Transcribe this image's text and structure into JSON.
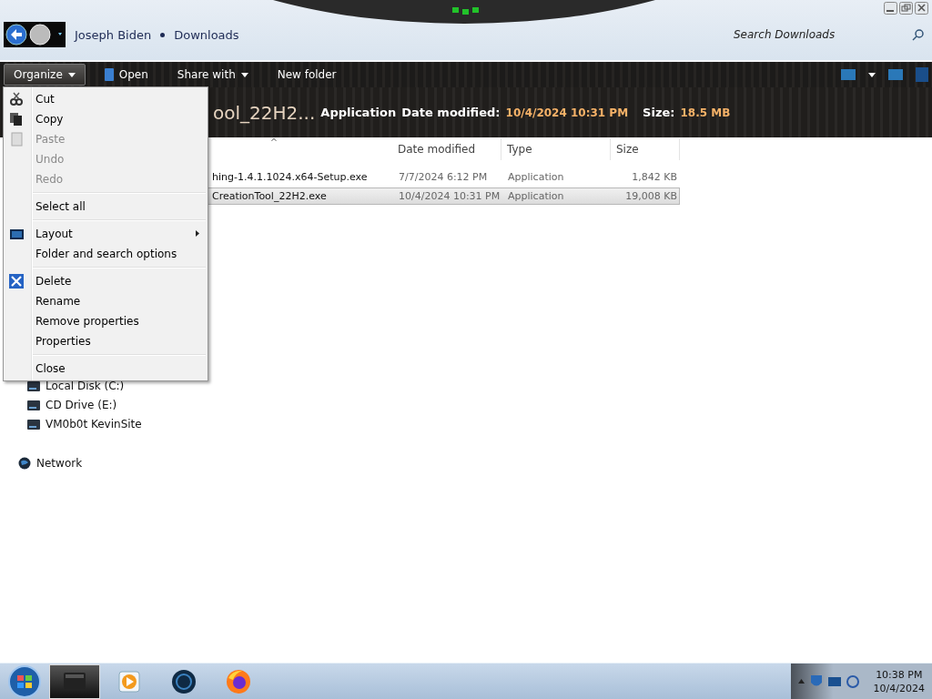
{
  "address": {
    "crumbs": [
      "Joseph Biden",
      "Downloads"
    ]
  },
  "search": {
    "placeholder": "Search Downloads"
  },
  "toolbar": {
    "buttons": [
      {
        "label": "Organize",
        "kind": "dropdown",
        "selected": true
      },
      {
        "label": "Open",
        "kind": "icon"
      },
      {
        "label": "Share with",
        "kind": "dropdown",
        "selected": false
      },
      {
        "label": "New folder",
        "kind": "plain"
      }
    ]
  },
  "details": {
    "title": "ool_22H2...",
    "type": "Application",
    "date_label": "Date modified:",
    "date": "10/4/2024 10:31 PM",
    "size_label": "Size:",
    "size": "18.5 MB"
  },
  "table": {
    "sort_mark": "^",
    "columns": [
      "Date modified",
      "Type",
      "Size"
    ],
    "rows": [
      {
        "name": "hing-1.4.1.1024.x64-Setup.exe",
        "date": "7/7/2024 6:12 PM",
        "type": "Application",
        "size": "1,842 KB",
        "selected": false
      },
      {
        "name": "CreationTool_22H2.exe",
        "date": "10/4/2024 10:31 PM",
        "type": "Application",
        "size": "19,008 KB",
        "selected": true
      }
    ]
  },
  "sidebar": {
    "drives": [
      "Local Disk (C:)",
      "CD Drive (E:)",
      "VM0b0t KevinSite"
    ],
    "network": "Network"
  },
  "menu": {
    "groups": [
      [
        {
          "label": "Cut",
          "disabled": false,
          "submenu": false
        },
        {
          "label": "Copy",
          "disabled": false,
          "submenu": false
        },
        {
          "label": "Paste",
          "disabled": true,
          "submenu": false
        },
        {
          "label": "Undo",
          "disabled": true,
          "submenu": false
        },
        {
          "label": "Redo",
          "disabled": true,
          "submenu": false
        }
      ],
      [
        {
          "label": "Select all",
          "disabled": false,
          "submenu": false
        }
      ],
      [
        {
          "label": "Layout",
          "disabled": false,
          "submenu": true
        },
        {
          "label": "Folder and search options",
          "disabled": false,
          "submenu": false
        }
      ],
      [
        {
          "label": "Delete",
          "disabled": false,
          "submenu": false
        },
        {
          "label": "Rename",
          "disabled": false,
          "submenu": false
        },
        {
          "label": "Remove properties",
          "disabled": false,
          "submenu": false
        },
        {
          "label": "Properties",
          "disabled": false,
          "submenu": false
        }
      ],
      [
        {
          "label": "Close",
          "disabled": false,
          "submenu": false
        }
      ]
    ]
  },
  "taskbar": {
    "apps": [
      {
        "kind": "explorer",
        "selected": true
      },
      {
        "kind": "media",
        "selected": false
      },
      {
        "kind": "globe",
        "selected": false
      },
      {
        "kind": "firefox",
        "selected": false
      }
    ],
    "time": "10:38 PM",
    "date": "10/4/2024"
  }
}
